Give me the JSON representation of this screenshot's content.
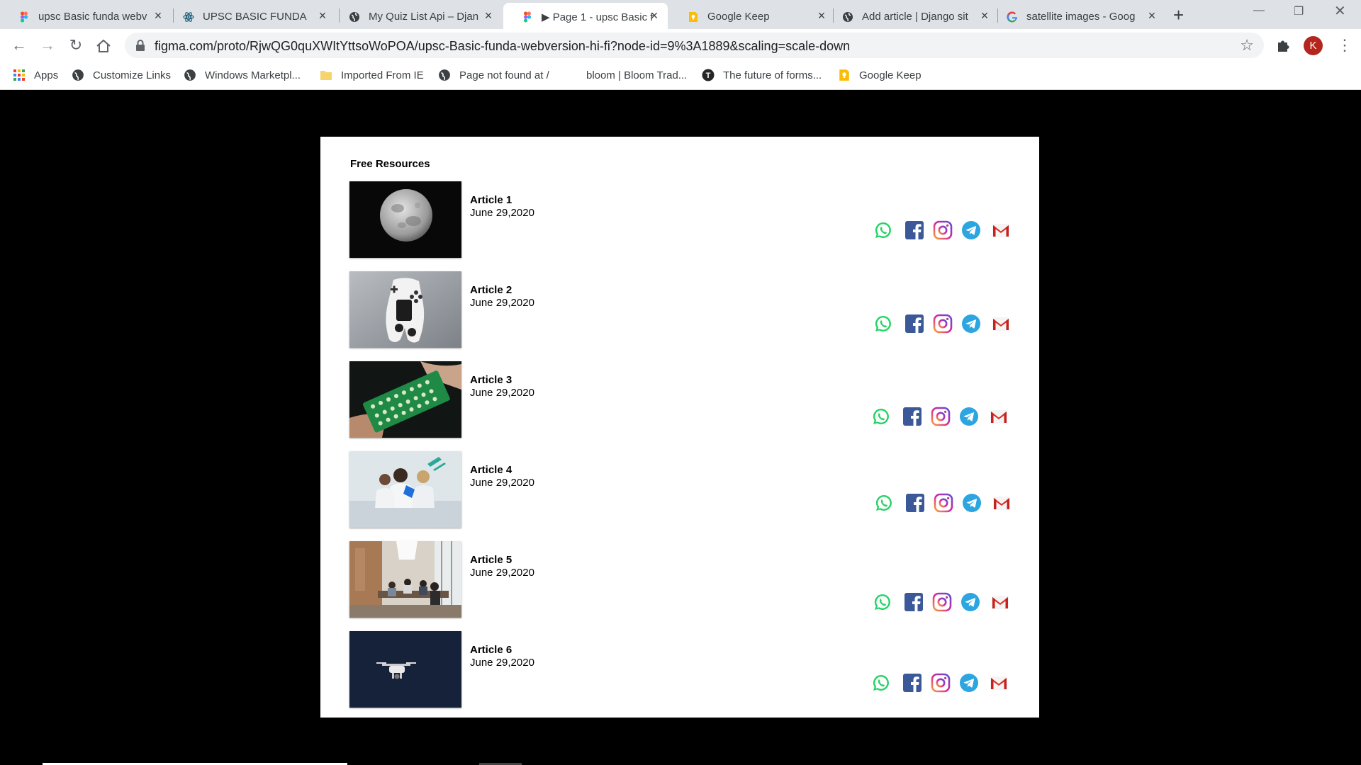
{
  "browser": {
    "tabs": [
      {
        "title": "upsc Basic funda webv",
        "favicon": "figma-icon",
        "active": false
      },
      {
        "title": "UPSC BASIC FUNDA",
        "favicon": "react-icon",
        "active": false
      },
      {
        "title": "My Quiz List Api – Djan",
        "favicon": "globe-icon",
        "active": false
      },
      {
        "title": "▶ Page 1 - upsc Basic f",
        "favicon": "figma-icon",
        "active": true
      },
      {
        "title": "Google Keep",
        "favicon": "keep-icon",
        "active": false
      },
      {
        "title": "Add article | Django sit",
        "favicon": "globe-icon",
        "active": false
      },
      {
        "title": "satellite images - Goog",
        "favicon": "google-icon",
        "active": false
      }
    ],
    "url": "figma.com/proto/RjwQG0quXWItYttsoWoPOA/upsc-Basic-funda-webversion-hi-fi?node-id=9%3A1889&scaling=scale-down",
    "profile_initial": "K",
    "bookmarks": [
      {
        "label": "Apps",
        "icon": "apps-grid-icon"
      },
      {
        "label": "Customize Links",
        "icon": "globe-icon"
      },
      {
        "label": "Windows Marketpl...",
        "icon": "globe-icon"
      },
      {
        "label": "Imported From IE",
        "icon": "folder-icon"
      },
      {
        "label": "Page not found at /",
        "icon": "globe-icon"
      },
      {
        "label": "bloom | Bloom Trad...",
        "icon": "none"
      },
      {
        "label": "The future of forms...",
        "icon": "typeform-icon"
      },
      {
        "label": "Google Keep",
        "icon": "keep-icon"
      }
    ]
  },
  "page": {
    "section_title": "Free Resources",
    "articles": [
      {
        "title": "Article 1",
        "date": "June 29,2020",
        "image": "moon"
      },
      {
        "title": "Article 2",
        "date": "June 29,2020",
        "image": "game-controller"
      },
      {
        "title": "Article 3",
        "date": "June 29,2020",
        "image": "circuit-board"
      },
      {
        "title": "Article 4",
        "date": "June 29,2020",
        "image": "lab-scientists"
      },
      {
        "title": "Article 5",
        "date": "June 29,2020",
        "image": "office-meeting"
      },
      {
        "title": "Article 6",
        "date": "June 29,2020",
        "image": "drone"
      }
    ],
    "share_icons": [
      "whatsapp-icon",
      "facebook-icon",
      "instagram-icon",
      "telegram-icon",
      "gmail-icon"
    ],
    "colors": {
      "whatsapp": "#25d366",
      "facebook": "#3b5998",
      "telegram": "#2ca5e0",
      "gmail": "#d93025",
      "background": "#000000",
      "panel": "#ffffff"
    }
  }
}
